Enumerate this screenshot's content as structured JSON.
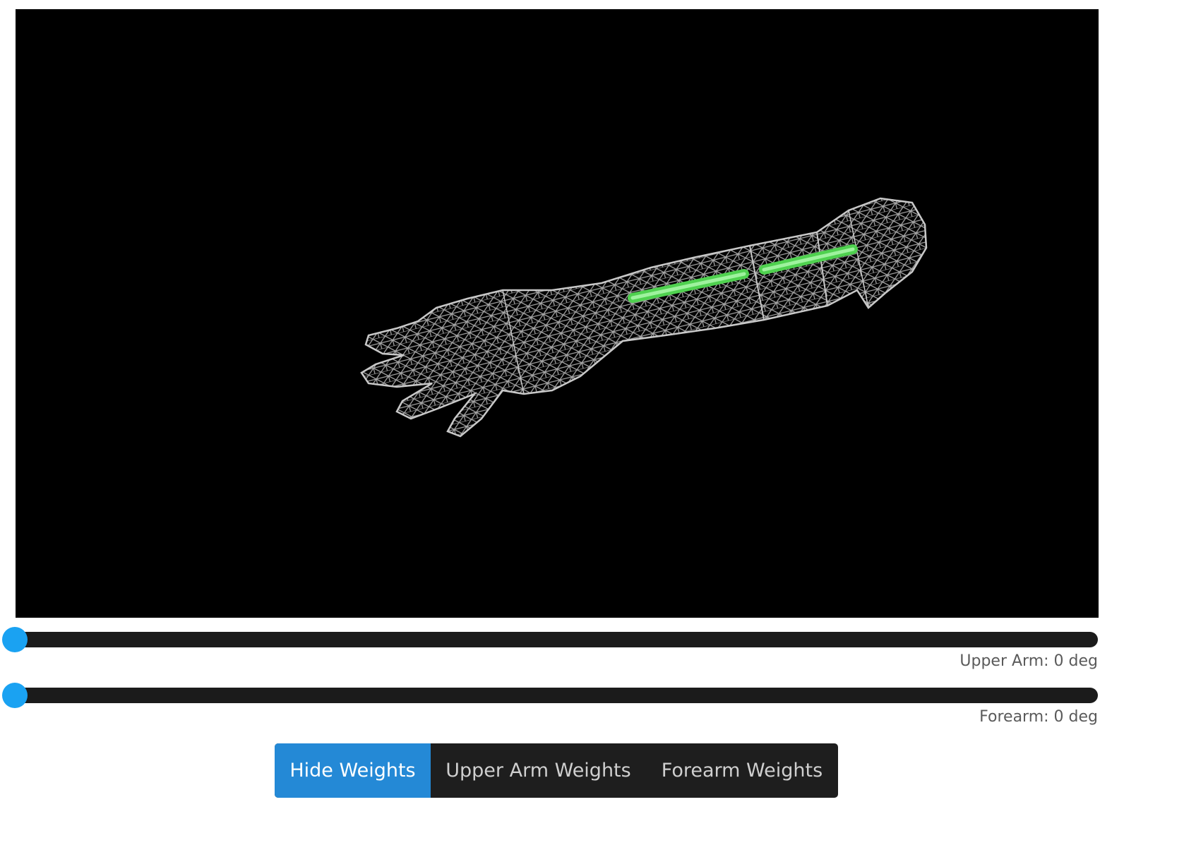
{
  "viewer": {
    "background": "#000000",
    "mesh_color": "#9a9a9a",
    "bone_color": "#6fe36f"
  },
  "sliders": [
    {
      "label": "Upper Arm: 0 deg",
      "value": 0,
      "accent": "#1aa2f2"
    },
    {
      "label": "Forearm: 0 deg",
      "value": 0,
      "accent": "#1aa2f2"
    }
  ],
  "buttons": {
    "hide_weights": "Hide Weights",
    "upper_arm_weights": "Upper Arm Weights",
    "forearm_weights": "Forearm Weights",
    "active": "hide_weights",
    "active_color": "#2489d6"
  }
}
